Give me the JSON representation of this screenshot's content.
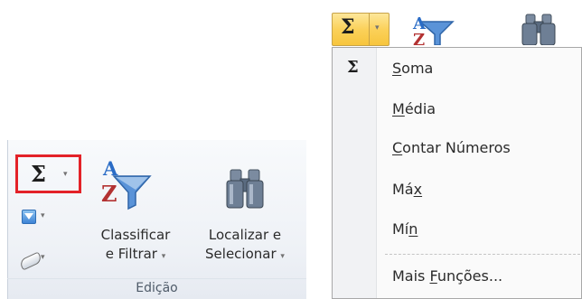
{
  "ribbon": {
    "group_label": "Edição",
    "autosum": {
      "symbol": "Σ",
      "caret": "▾"
    },
    "fill": {
      "caret": "▾"
    },
    "clear": {
      "caret": "▾"
    },
    "sort_filter": {
      "icon_top": "A",
      "icon_bottom": "Z",
      "line1": "Classificar",
      "line2": "e Filtrar",
      "caret": "▾"
    },
    "find_select": {
      "line1": "Localizar e",
      "line2": "Selecionar",
      "caret": "▾"
    }
  },
  "dropdown": {
    "button_symbol": "Σ",
    "button_caret": "▾",
    "gutter_symbol": "Σ",
    "items": [
      {
        "pre": "",
        "key": "S",
        "post": "oma"
      },
      {
        "pre": "",
        "key": "M",
        "post": "édia"
      },
      {
        "pre": "",
        "key": "C",
        "post": "ontar Números"
      },
      {
        "pre": "Má",
        "key": "x",
        "post": ""
      },
      {
        "pre": "Mí",
        "key": "n",
        "post": ""
      },
      {
        "pre": "Mais ",
        "key": "F",
        "post": "unções..."
      }
    ]
  },
  "colors": {
    "highlight_border": "#e32228",
    "button_active": "#fbd15a",
    "menu_background": "#fafafa",
    "funnel_blue": "#3c7fcf",
    "binoculars": "#5a6b80"
  },
  "icons": {
    "fill": "fill-down-icon",
    "clear": "eraser-icon",
    "sort_filter": "sort-filter-funnel-icon",
    "find_select": "binoculars-icon"
  }
}
